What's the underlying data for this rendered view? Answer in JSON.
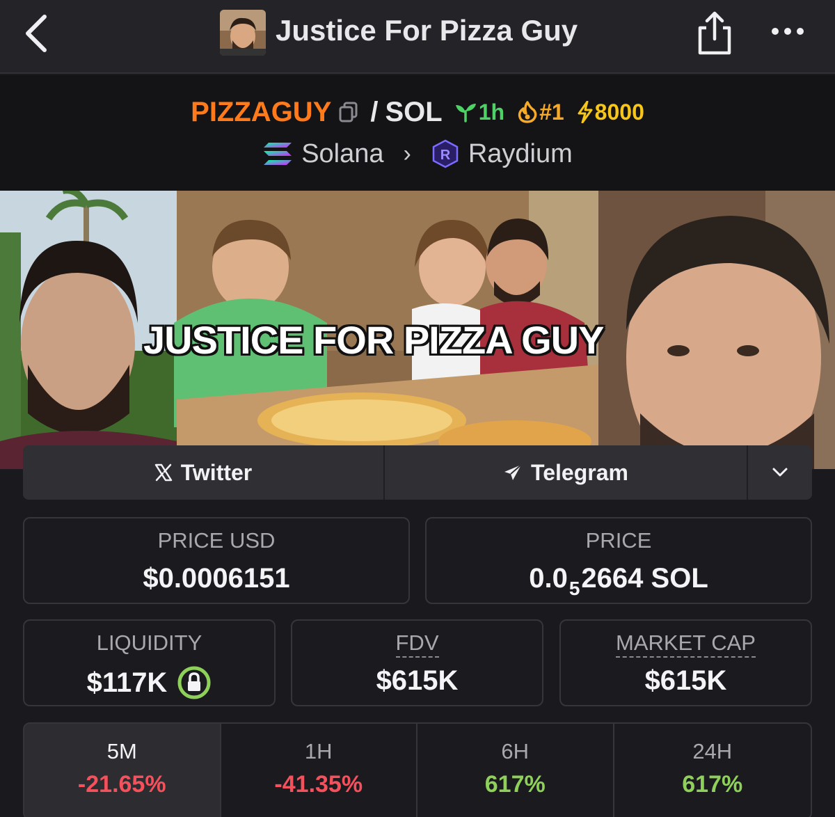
{
  "nav": {
    "title": "Justice For Pizza Guy",
    "back_icon": "chevron-left-icon",
    "share_icon": "share-icon",
    "more_icon": "more-horizontal-icon"
  },
  "pair": {
    "base_symbol": "PIZZAGUY",
    "separator": "/",
    "quote_symbol": "SOL",
    "age": "1h",
    "trending_rank": "#1",
    "boosts": "8000",
    "chain": "Solana",
    "dex": "Raydium",
    "colors": {
      "base_symbol": "#ff7a1a",
      "age": "#4ed266",
      "trending": "#f7a928",
      "boost": "#f7c61a"
    }
  },
  "banner": {
    "caption": "JUSTICE FOR PIZZA GUY"
  },
  "socials": {
    "twitter_label": "Twitter",
    "telegram_label": "Telegram"
  },
  "stats": {
    "price_usd_label": "PRICE USD",
    "price_usd_value": "$0.0006151",
    "price_label": "PRICE",
    "price_prefix": "0.0",
    "price_zero_count": "5",
    "price_digits": "2664 SOL",
    "liquidity_label": "LIQUIDITY",
    "liquidity_value": "$117K",
    "fdv_label": "FDV",
    "fdv_value": "$615K",
    "market_cap_label": "MARKET CAP",
    "market_cap_value": "$615K"
  },
  "timeframes": [
    {
      "label": "5M",
      "change": "-21.65%",
      "direction": "down",
      "active": true
    },
    {
      "label": "1H",
      "change": "-41.35%",
      "direction": "down",
      "active": false
    },
    {
      "label": "6H",
      "change": "617%",
      "direction": "up",
      "active": false
    },
    {
      "label": "24H",
      "change": "617%",
      "direction": "up",
      "active": false
    }
  ]
}
